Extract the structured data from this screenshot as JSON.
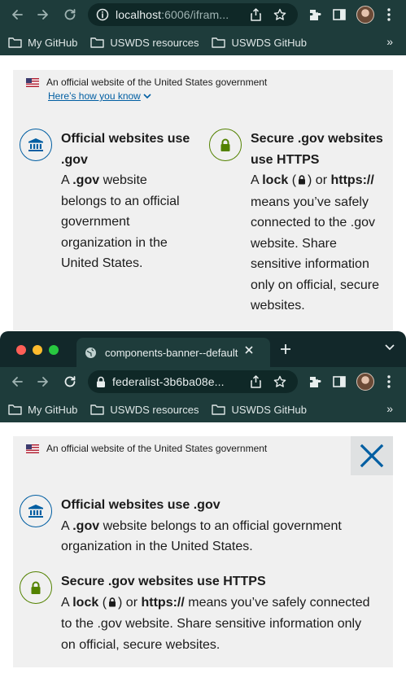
{
  "window1": {
    "url_host": "localhost",
    "url_rest": ":6006/ifram...",
    "bookmarks": [
      "My GitHub",
      "USWDS resources",
      "USWDS GitHub"
    ],
    "bookmarks_more": "»"
  },
  "window2": {
    "tab_title": "components-banner--default",
    "url": "federalist-3b6ba08e...",
    "bookmarks": [
      "My GitHub",
      "USWDS resources",
      "USWDS GitHub"
    ],
    "bookmarks_more": "»",
    "traffic_colors": [
      "#ff5f57",
      "#febc2e",
      "#28c840"
    ]
  },
  "banner": {
    "header_text": "An official website of the United States government",
    "how_link": "Here’s how you know",
    "dot_gov": {
      "title": "Official websites use .gov",
      "pre": "A ",
      "strong": ".gov",
      "post": " website belongs to an official government organization in the United States."
    },
    "https": {
      "title": "Secure .gov websites use HTTPS",
      "pre": "A ",
      "lock_word": "lock",
      "paren_open": " (",
      "paren_close": ") or ",
      "https_word": "https://",
      "post": " means you’ve safely connected to the .gov website. Share sensitive information only on official, secure websites."
    }
  },
  "colors": {
    "chrome_toolbar": "#1e3c3b",
    "banner_bg": "#f0f0f0",
    "link": "#005ea2",
    "https_green": "#538200",
    "close_bg": "#dfe1e2"
  }
}
